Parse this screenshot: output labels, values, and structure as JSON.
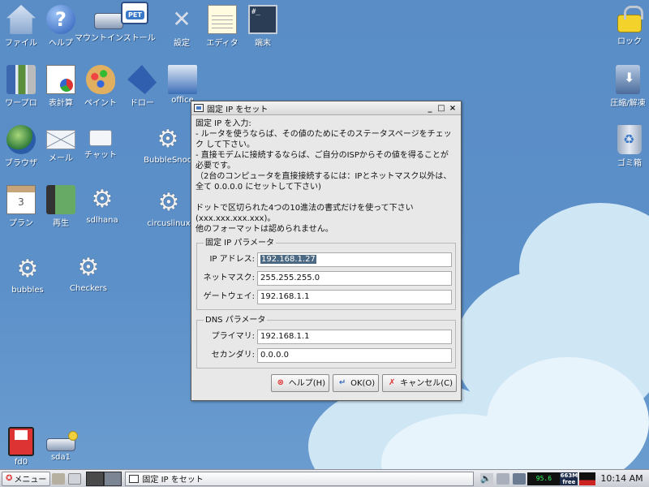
{
  "desktop": {
    "icons": {
      "file": "ファイル",
      "help": "ヘルプ",
      "mount": "マウントインストール",
      "settings": "設定",
      "editor": "エディタ",
      "terminal": "端末",
      "lock": "ロック",
      "wordpro": "ワープロ",
      "spreadsheet": "表計算",
      "paint": "ペイント",
      "draw": "ドロー",
      "office": "office",
      "archive": "圧縮/解凍",
      "browser": "ブラウザ",
      "mail": "メール",
      "chat": "チャット",
      "bubblesnoop": "BubbleSnoo",
      "trash": "ゴミ箱",
      "plan": "プラン",
      "play": "再生",
      "sdlhana": "sdlhana",
      "circuslinux": "circuslinux",
      "bubbles": "bubbles",
      "checkers": "Checkers",
      "fd0": "fd0",
      "sda1": "sda1"
    },
    "icon_glyphs": {
      "terminal": "#_",
      "plan": "3",
      "pet": "PET"
    }
  },
  "dialog": {
    "title": "固定 IP をセット",
    "desc": [
      "固定 IP を入力:",
      "- ルータを使うならば、その値のためにそのステータスページをチェッ",
      "ク して下さい。",
      "- 直接モデムに接続するならば、ご自分のISPからその値を得ることが",
      "必要です。",
      "（2台のコンピュータを直接接続するには：IPとネットマスク以外は、",
      "全て 0.0.0.0 にセットして下さい)",
      "",
      "ドットで区切られた4つの10進法の書式だけを使って下さい",
      "(xxx.xxx.xxx.xxx)。",
      "他のフォーマットは認められません。"
    ],
    "ip_group": {
      "legend": "固定 IP パラメータ",
      "ip_label": "IP アドレス:",
      "ip_value": "192.168.1.27",
      "netmask_label": "ネットマスク:",
      "netmask_value": "255.255.255.0",
      "gateway_label": "ゲートウェイ:",
      "gateway_value": "192.168.1.1"
    },
    "dns_group": {
      "legend": "DNS パラメータ",
      "primary_label": "プライマリ:",
      "primary_value": "192.168.1.1",
      "secondary_label": "セカンダリ:",
      "secondary_value": "0.0.0.0"
    },
    "buttons": {
      "help": "ヘルプ(H)",
      "ok": "OK(O)",
      "cancel": "キャンセル(C)"
    },
    "window_buttons": {
      "minimize": "_",
      "maximize": "□",
      "close": "×"
    }
  },
  "taskbar": {
    "menu_label": "メニュー",
    "task_title": "固定 IP をセット",
    "cpu": "95.6",
    "mem_amount": "663M",
    "mem_label": "free",
    "clock": "10:14 AM"
  }
}
